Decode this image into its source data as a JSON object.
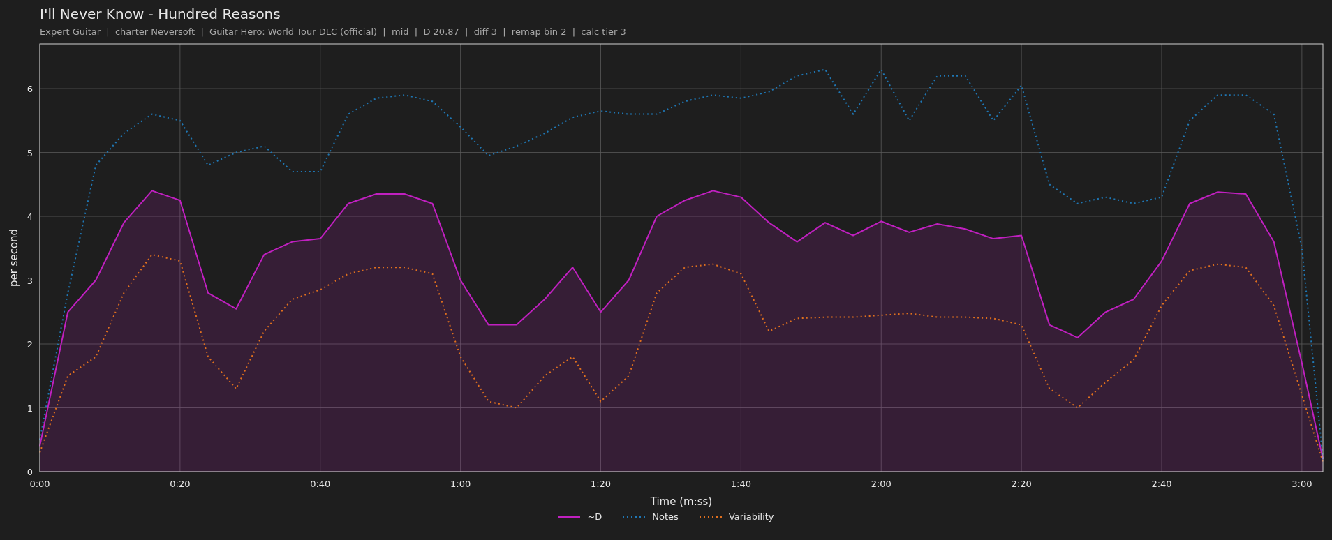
{
  "chart": {
    "subtitle": "Expert Guitar  |  charter Neversoft  |  Guitar Hero: World Tour DLC (official)  |  mid  |  D 20.87  |  diff 3  |  remap bin 2  |  calc tier 3",
    "chart_data": {
      "type": "line",
      "title": "I'll Never Know - Hundred Reasons",
      "xlabel": "Time (m:ss)",
      "ylabel": "per second",
      "x": [
        0,
        4,
        8,
        12,
        16,
        20,
        24,
        28,
        32,
        36,
        40,
        44,
        48,
        52,
        56,
        60,
        64,
        68,
        72,
        76,
        80,
        84,
        88,
        92,
        96,
        100,
        104,
        108,
        112,
        116,
        120,
        124,
        128,
        132,
        136,
        140,
        144,
        148,
        152,
        156,
        160,
        164,
        168,
        172,
        176,
        180,
        183
      ],
      "series": [
        {
          "name": "~D",
          "color": "#c020c0",
          "type": "area",
          "line_style": "solid",
          "values": [
            0.4,
            2.5,
            3.0,
            3.9,
            4.4,
            4.25,
            2.8,
            2.55,
            3.4,
            3.6,
            3.65,
            4.2,
            4.35,
            4.35,
            4.2,
            3.0,
            2.3,
            2.3,
            2.7,
            3.2,
            2.5,
            3.0,
            4.0,
            4.25,
            4.4,
            4.3,
            3.9,
            3.6,
            3.9,
            3.7,
            3.92,
            3.75,
            3.88,
            3.8,
            3.65,
            3.7,
            2.3,
            2.1,
            2.5,
            2.7,
            3.3,
            4.2,
            4.38,
            4.35,
            3.6,
            1.7,
            0.2
          ]
        },
        {
          "name": "Notes",
          "color": "#1f77b4",
          "type": "line",
          "line_style": "dotted",
          "values": [
            0.5,
            2.8,
            4.8,
            5.3,
            5.6,
            5.5,
            4.8,
            5.0,
            5.1,
            4.7,
            4.7,
            5.6,
            5.85,
            5.9,
            5.8,
            5.4,
            4.95,
            5.1,
            5.3,
            5.55,
            5.65,
            5.6,
            5.6,
            5.8,
            5.9,
            5.85,
            5.95,
            6.2,
            6.3,
            5.6,
            6.3,
            5.5,
            6.2,
            6.2,
            5.5,
            6.05,
            4.5,
            4.2,
            4.3,
            4.2,
            4.3,
            5.5,
            5.9,
            5.9,
            5.6,
            3.5,
            0.2
          ]
        },
        {
          "name": "Variability",
          "color": "#e0701e",
          "type": "line",
          "line_style": "dotted",
          "values": [
            0.3,
            1.5,
            1.8,
            2.8,
            3.4,
            3.3,
            1.8,
            1.3,
            2.2,
            2.7,
            2.85,
            3.1,
            3.2,
            3.2,
            3.1,
            1.8,
            1.1,
            1.0,
            1.5,
            1.8,
            1.1,
            1.5,
            2.8,
            3.2,
            3.25,
            3.1,
            2.2,
            2.4,
            2.42,
            2.42,
            2.45,
            2.48,
            2.42,
            2.42,
            2.4,
            2.3,
            1.3,
            1.0,
            1.4,
            1.75,
            2.6,
            3.15,
            3.25,
            3.2,
            2.6,
            1.2,
            0.15
          ]
        }
      ],
      "grid": true,
      "xlim": [
        0,
        183
      ],
      "ylim": [
        0,
        6.7
      ],
      "xticks": [
        {
          "value": 0,
          "label": "0:00"
        },
        {
          "value": 20,
          "label": "0:20"
        },
        {
          "value": 40,
          "label": "0:40"
        },
        {
          "value": 60,
          "label": "1:00"
        },
        {
          "value": 80,
          "label": "1:20"
        },
        {
          "value": 100,
          "label": "1:40"
        },
        {
          "value": 120,
          "label": "2:00"
        },
        {
          "value": 140,
          "label": "2:20"
        },
        {
          "value": 160,
          "label": "2:40"
        },
        {
          "value": 180,
          "label": "3:00"
        }
      ],
      "yticks": [
        0,
        1,
        2,
        3,
        4,
        5,
        6
      ]
    }
  }
}
